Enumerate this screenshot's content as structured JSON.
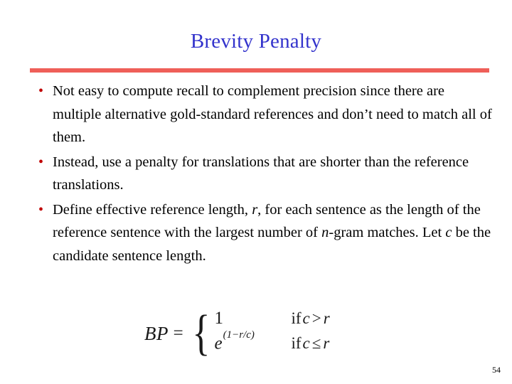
{
  "slide": {
    "title": "Brevity Penalty",
    "title_color": "#3333cc",
    "divider_color": "#ef5f59",
    "bullet_color": "#c00000",
    "bullet_marker": "•",
    "page_number": "54"
  },
  "bullets": [
    {
      "id": "bullet-recall",
      "segments": [
        {
          "text": "Not easy to compute recall to complement precision since there are multiple alternative gold-standard references and don’t need to match all of them.",
          "style": "normal"
        }
      ],
      "plain": "Not easy to compute recall to complement precision since there are multiple alternative gold-standard references and don’t need to match all of them."
    },
    {
      "id": "bullet-penalty",
      "segments": [
        {
          "text": "Instead, use a penalty for translations that are shorter than the reference translations.",
          "style": "normal"
        }
      ],
      "plain": "Instead, use a penalty for translations that are shorter than the reference translations."
    },
    {
      "id": "bullet-definition",
      "segments": [
        {
          "text": "Define effective reference length, ",
          "style": "normal"
        },
        {
          "text": "r",
          "style": "italic"
        },
        {
          "text": ", for each sentence as the length of the reference sentence with the largest number of ",
          "style": "normal"
        },
        {
          "text": "n",
          "style": "italic"
        },
        {
          "text": "-gram matches.  Let  ",
          "style": "normal"
        },
        {
          "text": "c",
          "style": "italic"
        },
        {
          "text": " be the candidate sentence length.",
          "style": "normal"
        }
      ],
      "plain": "Define effective reference length, r, for each sentence as the length of the reference sentence with the largest number of n-gram matches.  Let  c be the candidate sentence length."
    }
  ],
  "formula": {
    "name": "brevity-penalty-equation",
    "lhs": "BP",
    "equals": "=",
    "open_brace": "{",
    "cases": [
      {
        "value_base": "1",
        "value_exponent": "",
        "condition_keyword": "if",
        "condition_left": "c",
        "condition_operator": ">",
        "condition_right": "r",
        "condition_plain": "if c > r"
      },
      {
        "value_base": "e",
        "value_exponent": "(1−r/c)",
        "condition_keyword": "if",
        "condition_left": "c",
        "condition_operator": "≤",
        "condition_right": "r",
        "condition_plain": "if c ≤ r"
      }
    ],
    "plain": "BP = 1 if c > r ;  e^(1−r/c) if c ≤ r"
  }
}
